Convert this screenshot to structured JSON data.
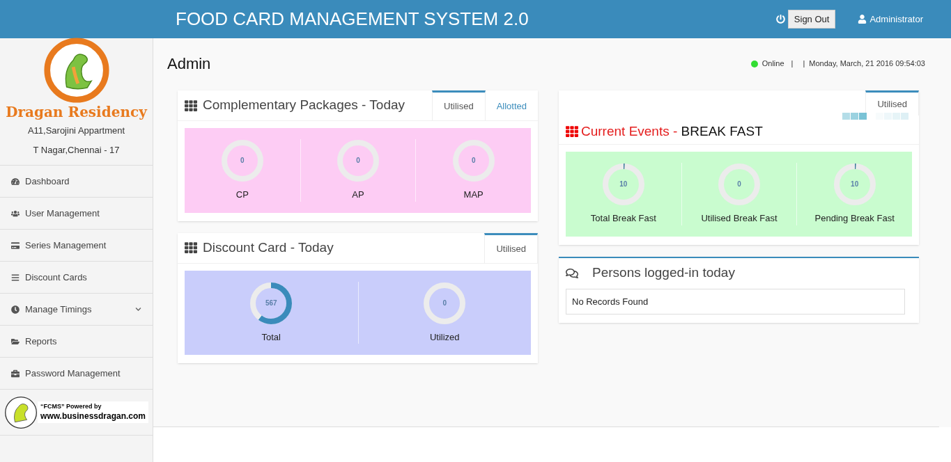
{
  "header": {
    "title": "FOOD CARD MANAGEMENT SYSTEM 2.0",
    "sign_out": "Sign Out",
    "user": "Administrator"
  },
  "sidebar": {
    "brand": "Dragan Residency",
    "address_line_1": "A11,Sarojini Appartment",
    "address_line_2": "T Nagar,Chennai - 17",
    "items": [
      {
        "label": "Dashboard",
        "has_submenu": false
      },
      {
        "label": "User Management",
        "has_submenu": false
      },
      {
        "label": "Series Management",
        "has_submenu": false
      },
      {
        "label": "Discount Cards",
        "has_submenu": false
      },
      {
        "label": "Manage Timings",
        "has_submenu": true
      },
      {
        "label": "Reports",
        "has_submenu": false
      },
      {
        "label": "Password Management",
        "has_submenu": false
      }
    ],
    "powered_by": {
      "line_1": "“FCMS” Powered by",
      "line_2": "www.businessdragan.com"
    }
  },
  "page": {
    "title": "Admin",
    "status": "Online",
    "separator_1": "|",
    "separator_2": "|",
    "datetime": "Monday, March, 21 2016 09:54:03"
  },
  "complementary": {
    "title": "Complementary Packages - Today",
    "tabs": [
      {
        "label": "Utilised",
        "selected": true
      },
      {
        "label": "Allotted",
        "selected": false
      }
    ],
    "gauges": [
      {
        "value": "0",
        "label": "CP",
        "level": 0
      },
      {
        "value": "0",
        "label": "AP",
        "level": 0
      },
      {
        "value": "0",
        "label": "MAP",
        "level": 0
      }
    ]
  },
  "discount": {
    "title": "Discount Card - Today",
    "tabs": [
      {
        "label": "Utilised",
        "selected": true
      }
    ],
    "gauges": [
      {
        "value": "567",
        "label": "Total",
        "level": 0.6
      },
      {
        "value": "0",
        "label": "Utilized",
        "level": 0
      }
    ]
  },
  "events": {
    "title_prefix": "Current Events - ",
    "title_event": "BREAK FAST",
    "tabs": [
      {
        "label": "Utilised",
        "selected": true
      }
    ],
    "gauges": [
      {
        "value": "10",
        "label": "Total Break Fast",
        "level": 0.005
      },
      {
        "value": "0",
        "label": "Utilised Break Fast",
        "level": 0
      },
      {
        "value": "10",
        "label": "Pending Break Fast",
        "level": 0.005
      }
    ]
  },
  "logged_in": {
    "title": "Persons logged-in today",
    "empty": "No Records Found"
  }
}
